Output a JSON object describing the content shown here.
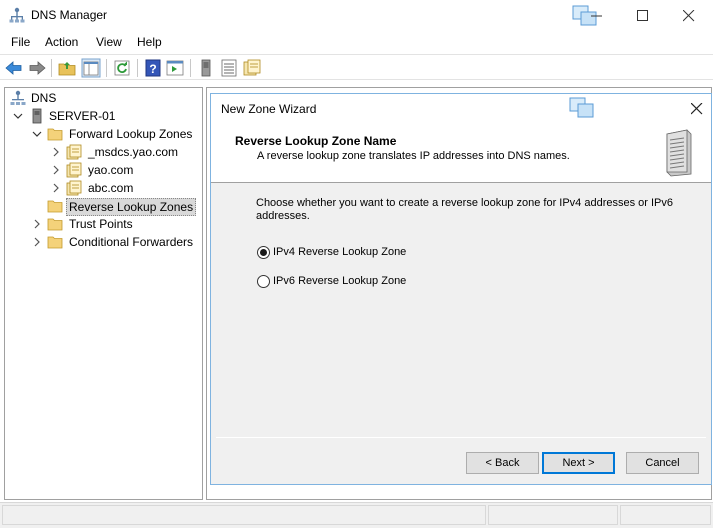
{
  "window": {
    "title": "DNS Manager",
    "icon": "dns-icon"
  },
  "menu": {
    "items": [
      "File",
      "Action",
      "View",
      "Help"
    ]
  },
  "toolbar": {
    "buttons": [
      "back-icon",
      "forward-icon",
      "up-folder-icon",
      "show-hide-tree-icon",
      "refresh-icon",
      "help-icon",
      "properties-icon",
      "server-icon",
      "list-icon",
      "zone-icon"
    ]
  },
  "tree": {
    "root": "DNS",
    "server": "SERVER-01",
    "forward": "Forward Lookup Zones",
    "zones": [
      "_msdcs.yao.com",
      "yao.com",
      "abc.com"
    ],
    "reverse": "Reverse Lookup Zones",
    "trust": "Trust Points",
    "conditional": "Conditional Forwarders"
  },
  "wizard": {
    "title": "New Zone Wizard",
    "header_title": "Reverse Lookup Zone Name",
    "header_subtitle": "A reverse lookup zone translates IP addresses into DNS names.",
    "description": "Choose whether you want to create a reverse lookup zone for IPv4 addresses or IPv6 addresses.",
    "options": [
      {
        "label": "IPv4 Reverse Lookup Zone",
        "checked": true
      },
      {
        "label": "IPv6 Reverse Lookup Zone",
        "checked": false
      }
    ],
    "buttons": {
      "back": "< Back",
      "next": "Next >",
      "cancel": "Cancel"
    }
  },
  "colors": {
    "accent": "#0078d7",
    "folder": "#e8c25a",
    "selected": "#d9d9d9"
  }
}
